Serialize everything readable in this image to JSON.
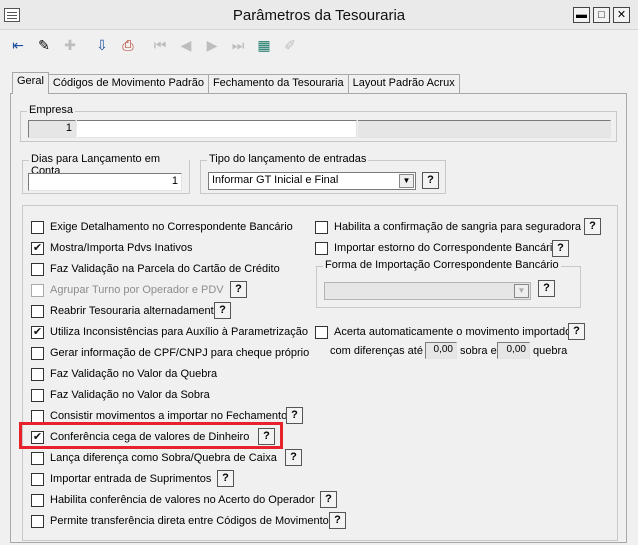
{
  "window": {
    "title": "Parâmetros da Tesouraria",
    "controls": {
      "minimize": "▬",
      "maximize": "□",
      "close": "✕"
    }
  },
  "toolbar": {
    "buttons": [
      {
        "icon": "exit-icon",
        "glyph": "⇤",
        "enabled": true
      },
      {
        "icon": "eraser-icon",
        "glyph": "✎",
        "enabled": true
      },
      {
        "icon": "add-icon",
        "glyph": "✚",
        "enabled": false
      },
      {
        "icon": "save-icon",
        "glyph": "⇩",
        "enabled": true
      },
      {
        "icon": "print-icon",
        "glyph": "⎙",
        "enabled": true
      },
      {
        "icon": "first-icon",
        "glyph": "⏮",
        "enabled": false
      },
      {
        "icon": "prev-icon",
        "glyph": "◀",
        "enabled": false
      },
      {
        "icon": "next-icon",
        "glyph": "▶",
        "enabled": false
      },
      {
        "icon": "last-icon",
        "glyph": "⏭",
        "enabled": false
      },
      {
        "icon": "grid-icon",
        "glyph": "▦",
        "enabled": true
      },
      {
        "icon": "edit-icon",
        "glyph": "✐",
        "enabled": false
      }
    ]
  },
  "tabs": [
    {
      "label": "Geral",
      "active": true
    },
    {
      "label": "Códigos de Movimento Padrão",
      "active": false
    },
    {
      "label": "Fechamento da Tesouraria",
      "active": false
    },
    {
      "label": "Layout Padrão Acrux",
      "active": false
    }
  ],
  "empresa": {
    "legend": "Empresa",
    "code": "1"
  },
  "dias": {
    "legend": "Dias para Lançamento em Conta",
    "value": "1"
  },
  "tipo": {
    "legend": "Tipo do lançamento de entradas",
    "selected": "Informar GT Inicial e Final"
  },
  "help_label": "?",
  "left_options": [
    {
      "label": "Exige Detalhamento no Correspondente Bancário",
      "checked": false,
      "enabled": true,
      "help": false
    },
    {
      "label": "Mostra/Importa Pdvs Inativos",
      "checked": true,
      "enabled": true,
      "help": false
    },
    {
      "label": "Faz Validação na Parcela do Cartão de Crédito",
      "checked": false,
      "enabled": true,
      "help": false
    },
    {
      "label": "Agrupar Turno por Operador e PDV",
      "checked": false,
      "enabled": false,
      "help": true
    },
    {
      "label": "Reabrir Tesouraria alternadamente",
      "checked": false,
      "enabled": true,
      "help": true
    },
    {
      "label": "Utiliza Inconsistências para Auxílio à Parametrização",
      "checked": true,
      "enabled": true,
      "help": false
    },
    {
      "label": "Gerar informação de CPF/CNPJ para cheque próprio",
      "checked": false,
      "enabled": true,
      "help": false
    },
    {
      "label": "Faz Validação no Valor da Quebra",
      "checked": false,
      "enabled": true,
      "help": false
    },
    {
      "label": "Faz Validação no Valor da Sobra",
      "checked": false,
      "enabled": true,
      "help": false
    },
    {
      "label": "Consistir movimentos a importar no Fechamento",
      "checked": false,
      "enabled": true,
      "help": true
    },
    {
      "label": "Conferência cega de valores de Dinheiro",
      "checked": true,
      "enabled": true,
      "help": true
    },
    {
      "label": "Lança diferença como Sobra/Quebra de Caixa",
      "checked": false,
      "enabled": true,
      "help": true
    },
    {
      "label": "Importar entrada de Suprimentos",
      "checked": false,
      "enabled": true,
      "help": true
    },
    {
      "label": "Habilita conferência de valores no Acerto do Operador",
      "checked": false,
      "enabled": true,
      "help": true
    },
    {
      "label": "Permite transferência direta entre Códigos de Movimento",
      "checked": false,
      "enabled": true,
      "help": true
    }
  ],
  "right_options": {
    "sangria": {
      "label": "Habilita a confirmação de sangria para seguradora",
      "checked": false
    },
    "estorno": {
      "label": "Importar estorno do Correspondente Bancário",
      "checked": false
    },
    "forma_importacao": {
      "legend": "Forma de Importação Correspondente Bancário",
      "selected": ""
    },
    "acerta": {
      "label": "Acerta automaticamente o movimento importado",
      "checked": false,
      "line2_prefix": "com diferenças até",
      "sobra_value": "0,00",
      "sobra_label": "sobra e",
      "quebra_value": "0,00",
      "quebra_label": "quebra"
    }
  }
}
